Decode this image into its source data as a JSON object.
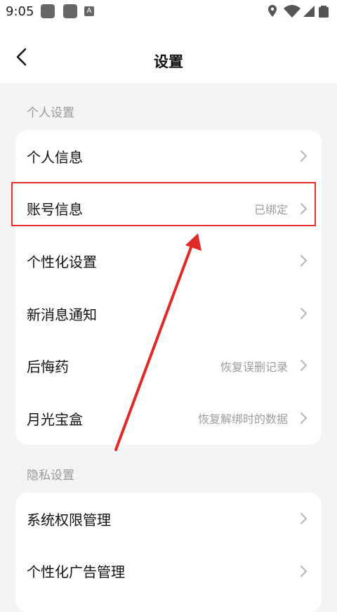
{
  "status_bar": {
    "time": "9:05",
    "notification_letter": "A",
    "icons": [
      "app-square-icon",
      "app-square-icon",
      "a-icon",
      "location-icon",
      "wifi-icon",
      "signal-icon",
      "battery-icon"
    ]
  },
  "header": {
    "title": "设置",
    "back_icon": "chevron-left-icon"
  },
  "sections": [
    {
      "title": "个人设置",
      "items": [
        {
          "label": "个人信息",
          "value": ""
        },
        {
          "label": "账号信息",
          "value": "已绑定"
        },
        {
          "label": "个性化设置",
          "value": ""
        },
        {
          "label": "新消息通知",
          "value": ""
        },
        {
          "label": "后悔药",
          "value": "恢复误删记录"
        },
        {
          "label": "月光宝盒",
          "value": "恢复解绑时的数据"
        }
      ]
    },
    {
      "title": "隐私设置",
      "items": [
        {
          "label": "系统权限管理",
          "value": ""
        },
        {
          "label": "个性化广告管理",
          "value": ""
        }
      ]
    }
  ],
  "colors": {
    "background": "#f4f4f6",
    "annotation": "#e03030"
  }
}
